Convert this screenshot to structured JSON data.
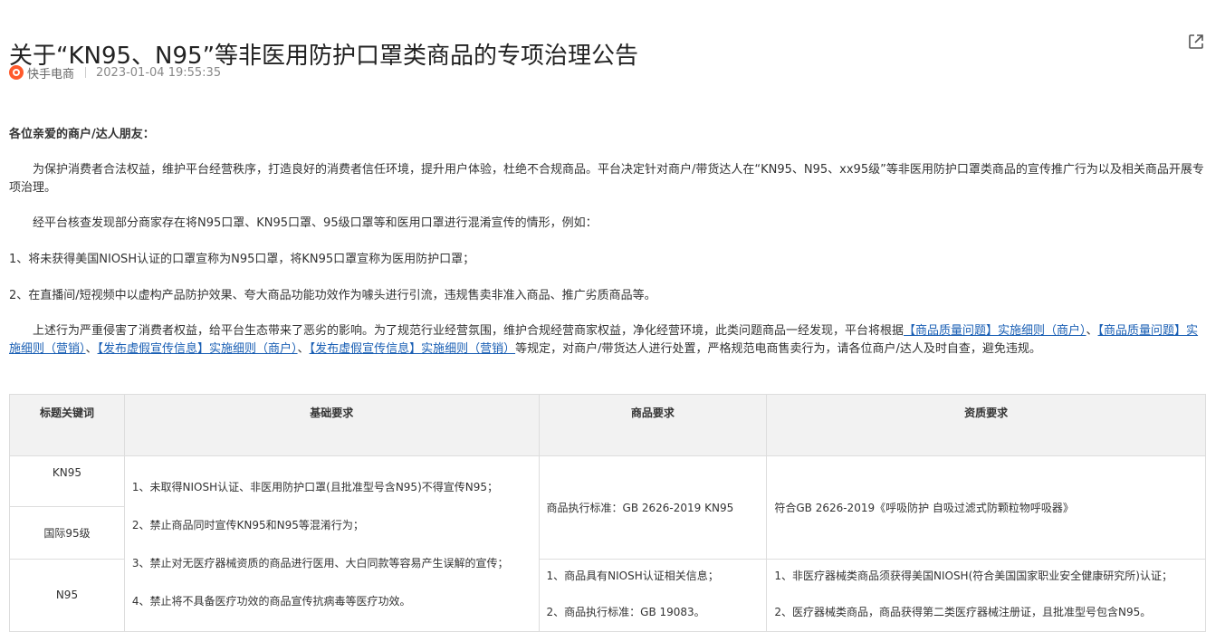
{
  "article": {
    "title": "关于“KN95、N95”等非医用防护口罩类商品的专项治理公告",
    "source": "快手电商",
    "datetime": "2023-01-04 19:55:35"
  },
  "body": {
    "greeting": "各位亲爱的商户/达人朋友：",
    "para1": "为保护消费者合法权益，维护平台经营秩序，打造良好的消费者信任环境，提升用户体验，杜绝不合规商品。平台决定针对商户/带货达人在“KN95、N95、xx95级”等非医用防护口罩类商品的宣传推广行为以及相关商品开展专项治理。",
    "para2": "经平台核查发现部分商家存在将N95口罩、KN95口罩、95级口罩等和医用口罩进行混淆宣传的情形，例如：",
    "item1": "1、将未获得美国NIOSH认证的口罩宣称为N95口罩，将KN95口罩宣称为医用防护口罩；",
    "item2": "2、在直播间/短视频中以虚构产品防护效果、夸大商品功能功效作为噱头进行引流，违规售卖非准入商品、推广劣质商品等。",
    "para3_start": "上述行为严重侵害了消费者权益，给平台生态带来了恶劣的影响。为了规范行业经营氛围，维护合规经营商家权益，净化经营环境，此类问题商品一经发现，平台将根据",
    "link1": "【商品质量问题】实施细则（商户）",
    "comma1": "、",
    "link2": "【商品质量问题】实施细则（营销）",
    "comma2": "、",
    "link3": "【发布虚假宣传信息】实施细则（商户）",
    "comma3": "、",
    "link4": "【发布虚假宣传信息】实施细则（营销）",
    "para3_end": "等规定，对商户/带货达人进行处置，严格规范电商售卖行为，请各位商户/达人及时自查，避免违规。"
  },
  "table": {
    "headers": [
      "标题关键词",
      "基础要求",
      "商品要求",
      "资质要求"
    ],
    "kw_kn95": "KN95",
    "kw_intl95": "国际95级",
    "kw_n95": "N95",
    "basic": [
      "1、未取得NIOSH认证、非医用防护口罩(且批准型号含N95)不得宣传N95；",
      "2、禁止商品同时宣传KN95和N95等混淆行为；",
      "3、禁止对无医疗器械资质的商品进行医用、大白同款等容易产生误解的宣传；",
      "4、禁止将不具备医疗功效的商品宣传抗病毒等医疗功效。"
    ],
    "goods_kn95": "商品执行标准：GB 2626-2019 KN95",
    "qual_kn95": "符合GB 2626-2019《呼吸防护 自吸过滤式防颗粒物呼吸器》",
    "goods_n95": [
      "1、商品具有NIOSH认证相关信息；",
      "2、商品执行标准：GB 19083。"
    ],
    "qual_n95": [
      "1、非医疗器械类商品须获得美国NIOSH(符合美国国家职业安全健康研究所)认证；",
      "2、医疗器械类商品，商品获得第二类医疗器械注册证，且批准型号包含N95。"
    ]
  },
  "icons": {
    "share": "external-link-icon",
    "logo": "kuaishou-logo-icon"
  },
  "colors": {
    "link": "#1a5fb4",
    "logo": "#ff5a2c",
    "header_bg": "#f2f2f2"
  }
}
